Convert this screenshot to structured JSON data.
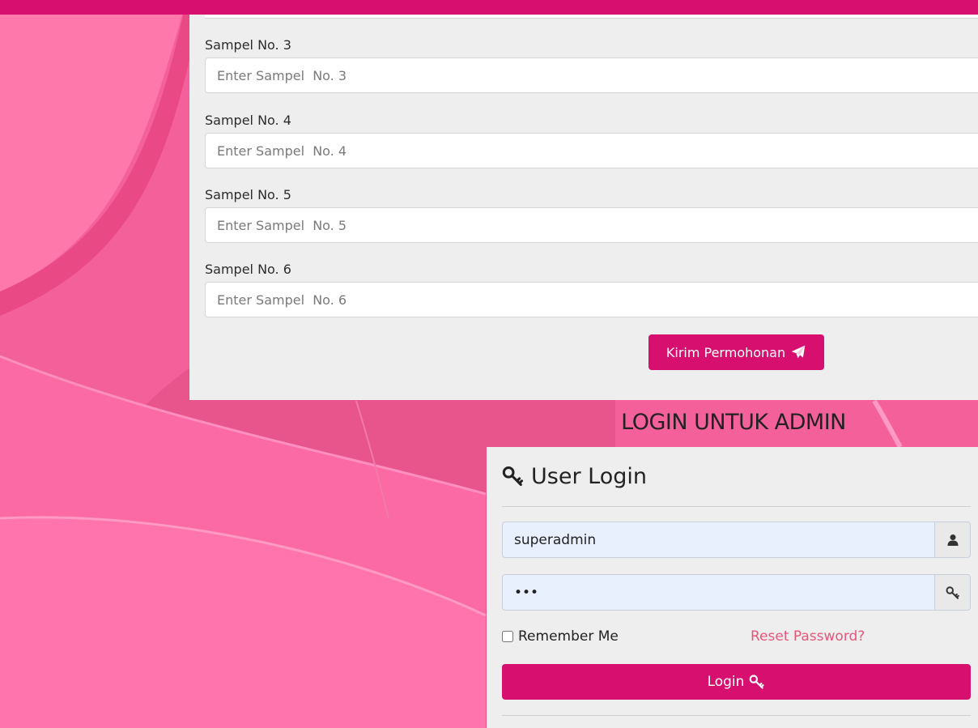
{
  "form": {
    "fields": [
      {
        "label": "Sampel No. 3",
        "placeholder": "Enter Sampel  No. 3"
      },
      {
        "label": "Sampel No. 4",
        "placeholder": "Enter Sampel  No. 4"
      },
      {
        "label": "Sampel No. 5",
        "placeholder": "Enter Sampel  No. 5"
      },
      {
        "label": "Sampel No. 6",
        "placeholder": "Enter Sampel  No. 6"
      }
    ],
    "submit_label": "Kirim Permohonan",
    "submit_icon": "paper-plane-icon"
  },
  "admin": {
    "heading": "LOGIN UNTUK ADMIN"
  },
  "login": {
    "title": "User Login",
    "title_icon": "key-icon",
    "username_value": "superadmin",
    "username_icon": "user-icon",
    "password_value": "•••",
    "password_icon": "key-icon",
    "remember_label": "Remember Me",
    "reset_label": "Reset Password?",
    "button_label": "Login",
    "button_icon": "key-icon"
  },
  "colors": {
    "brand": "#d70f6f",
    "background": "#f4619a",
    "panel": "#eeeeee",
    "link": "#e8567a",
    "autofill": "#e8f0fe"
  }
}
